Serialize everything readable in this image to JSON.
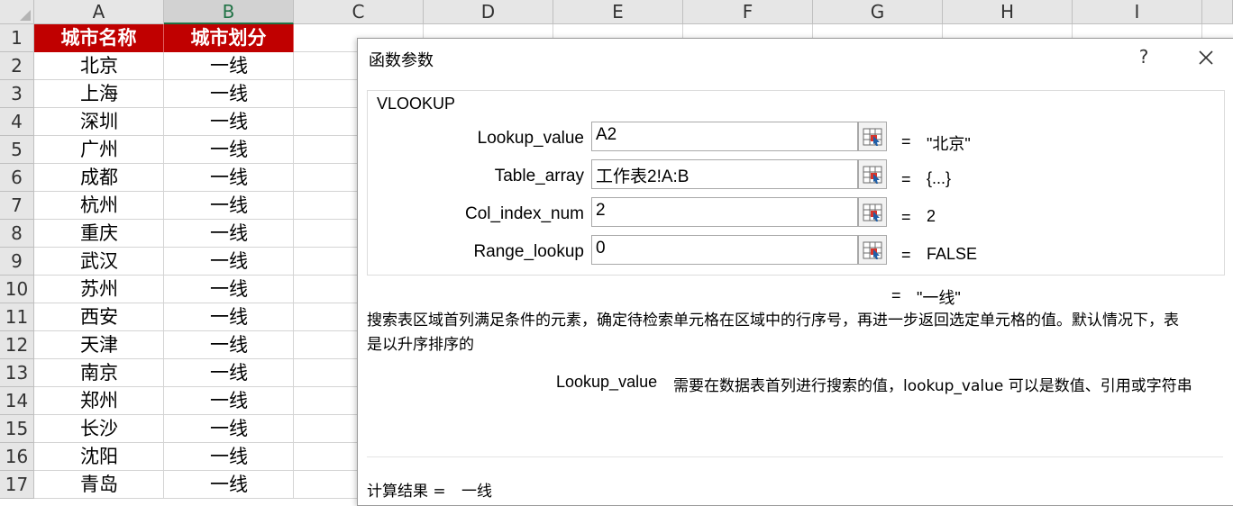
{
  "sheet": {
    "columns": [
      "A",
      "B",
      "C",
      "D",
      "E",
      "F",
      "G",
      "H",
      "I"
    ],
    "rows": [
      "1",
      "2",
      "3",
      "4",
      "5",
      "6",
      "7",
      "8",
      "9",
      "10",
      "11",
      "12",
      "13",
      "14",
      "15",
      "16",
      "17"
    ],
    "header_row": {
      "a": "城市名称",
      "b": "城市划分"
    },
    "data": [
      {
        "a": "北京",
        "b": "一线"
      },
      {
        "a": "上海",
        "b": "一线"
      },
      {
        "a": "深圳",
        "b": "一线"
      },
      {
        "a": "广州",
        "b": "一线"
      },
      {
        "a": "成都",
        "b": "一线"
      },
      {
        "a": "杭州",
        "b": "一线"
      },
      {
        "a": "重庆",
        "b": "一线"
      },
      {
        "a": "武汉",
        "b": "一线"
      },
      {
        "a": "苏州",
        "b": "一线"
      },
      {
        "a": "西安",
        "b": "一线"
      },
      {
        "a": "天津",
        "b": "一线"
      },
      {
        "a": "南京",
        "b": "一线"
      },
      {
        "a": "郑州",
        "b": "一线"
      },
      {
        "a": "长沙",
        "b": "一线"
      },
      {
        "a": "沈阳",
        "b": "一线"
      },
      {
        "a": "青岛",
        "b": "一线"
      }
    ],
    "colors": {
      "header_bg": "#c00000",
      "header_text": "#ffffff",
      "selected_col_text": "#217346"
    }
  },
  "dialog": {
    "title": "函数参数",
    "help": "?",
    "function_name": "VLOOKUP",
    "args": [
      {
        "label": "Lookup_value",
        "value": "A2",
        "eq": "=",
        "result": "\"北京\""
      },
      {
        "label": "Table_array",
        "value": "工作表2!A:B",
        "eq": "=",
        "result": "{...}"
      },
      {
        "label": "Col_index_num",
        "value": "2",
        "eq": "=",
        "result": "2"
      },
      {
        "label": "Range_lookup",
        "value": "0",
        "eq": "=",
        "result": "FALSE"
      }
    ],
    "result_eq": "=",
    "result_value": "\"一线\"",
    "description_line1": "搜索表区域首列满足条件的元素，确定待检索单元格在区域中的行序号，再进一步返回选定单元格的值。默认情况下，表",
    "description_line2": "是以升序排序的",
    "arg_help_name": "Lookup_value",
    "arg_help_text": "需要在数据表首列进行搜索的值，lookup_value 可以是数值、引用或字符串",
    "calc_label": "计算结果 =",
    "calc_value": "一线"
  }
}
